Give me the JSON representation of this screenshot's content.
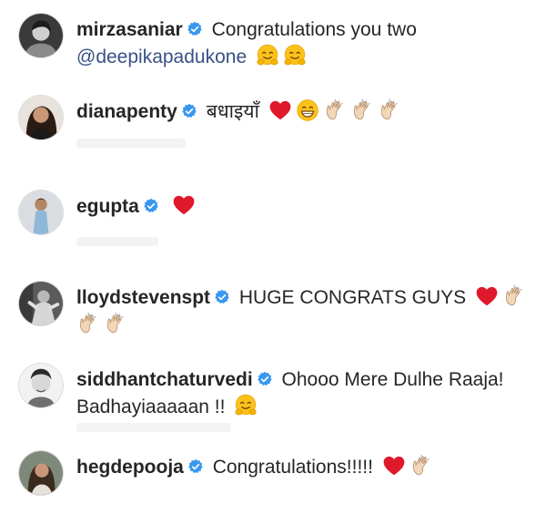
{
  "comments": [
    {
      "username": "mirzasaniar",
      "line1": "Congratulations you two",
      "mention": "@deepikapadukone",
      "emojis": [
        "hug-emoji",
        "hug-emoji"
      ]
    },
    {
      "username": "dianapenty",
      "line1": "बधाइयाँ",
      "emojis": [
        "red-heart-emoji",
        "grin-emoji",
        "clap-emoji",
        "clap-emoji",
        "clap-emoji"
      ]
    },
    {
      "username": "egupta",
      "line1": "",
      "emojis": [
        "red-heart-emoji"
      ]
    },
    {
      "username": "lloydstevenspt",
      "line1": "HUGE CONGRATS GUYS",
      "emojis": [
        "red-heart-emoji",
        "clap-emoji",
        "clap-emoji",
        "clap-emoji"
      ]
    },
    {
      "username": "siddhantchaturvedi",
      "line1": "Ohooo Mere Dulhe Raaja!",
      "line2": "Badhayiaaaaan !!",
      "emojis": [
        "hug-emoji"
      ]
    },
    {
      "username": "hegdepooja",
      "line1": "Congratulations!!!!!",
      "emojis": [
        "red-heart-emoji",
        "clap-emoji"
      ]
    }
  ],
  "colors": {
    "verified_blue": "#3897f0",
    "mention_blue": "#385185",
    "heart_red": "#e0182b",
    "text": "#262626"
  }
}
